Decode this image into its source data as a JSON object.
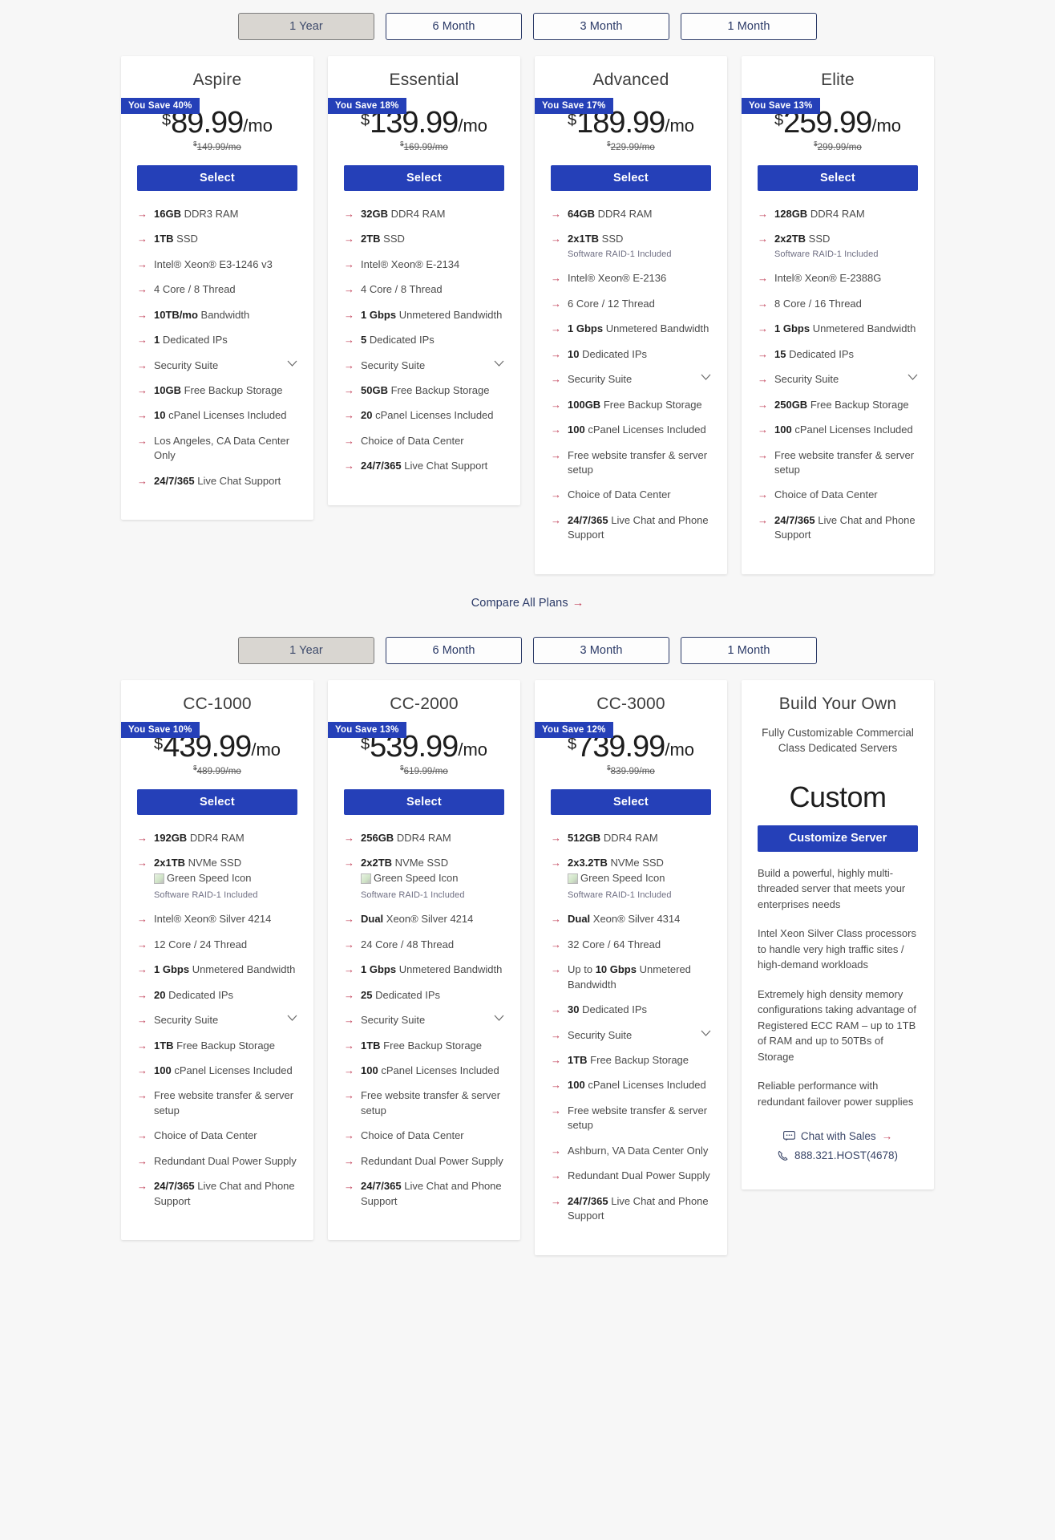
{
  "colors": {
    "accent_blue": "#2540b8",
    "arrow_red": "#c2415a",
    "navy": "#2b3a67",
    "page_bg": "#f7f7f7"
  },
  "terms_top": {
    "options": [
      {
        "label": "1 Year",
        "active": true
      },
      {
        "label": "6 Month",
        "active": false
      },
      {
        "label": "3 Month",
        "active": false
      },
      {
        "label": "1 Month",
        "active": false
      }
    ]
  },
  "terms_bottom": {
    "options": [
      {
        "label": "1 Year",
        "active": true
      },
      {
        "label": "6 Month",
        "active": false
      },
      {
        "label": "3 Month",
        "active": false
      },
      {
        "label": "1 Month",
        "active": false
      }
    ]
  },
  "compare": {
    "label": "Compare All Plans",
    "arrow": "→"
  },
  "select_label": "Select",
  "plans_top": [
    {
      "name": "Aspire",
      "save_badge": "You Save 40%",
      "currency": "$",
      "price": "89.99",
      "per": "/mo",
      "old_currency": "$",
      "old_price": "149.99/mo",
      "features": [
        {
          "bold": "16GB",
          "text": " DDR3 RAM"
        },
        {
          "bold": "1TB",
          "text": " SSD"
        },
        {
          "bold": "",
          "text": "Intel® Xeon® E3-1246 v3"
        },
        {
          "bold": "",
          "text": "4 Core / 8 Thread"
        },
        {
          "bold": "10TB/mo",
          "text": " Bandwidth"
        },
        {
          "bold": "1",
          "text": " Dedicated IPs"
        },
        {
          "bold": "",
          "text": "Security Suite",
          "chevron": true
        },
        {
          "bold": "10GB",
          "text": " Free Backup Storage"
        },
        {
          "bold": "10",
          "text": " cPanel Licenses Included"
        },
        {
          "bold": "",
          "text": "Los Angeles, CA Data Center Only"
        },
        {
          "bold": "24/7/365",
          "text": " Live Chat Support"
        }
      ]
    },
    {
      "name": "Essential",
      "save_badge": "You Save 18%",
      "currency": "$",
      "price": "139.99",
      "per": "/mo",
      "old_currency": "$",
      "old_price": "169.99/mo",
      "features": [
        {
          "bold": "32GB",
          "text": " DDR4 RAM"
        },
        {
          "bold": "2TB",
          "text": " SSD"
        },
        {
          "bold": "",
          "text": "Intel® Xeon® E-2134"
        },
        {
          "bold": "",
          "text": "4 Core / 8 Thread"
        },
        {
          "bold": "1 Gbps",
          "text": " Unmetered Bandwidth"
        },
        {
          "bold": "5",
          "text": " Dedicated IPs"
        },
        {
          "bold": "",
          "text": "Security Suite",
          "chevron": true
        },
        {
          "bold": "50GB",
          "text": " Free Backup Storage"
        },
        {
          "bold": "20",
          "text": " cPanel Licenses Included"
        },
        {
          "bold": "",
          "text": "Choice of Data Center"
        },
        {
          "bold": "24/7/365",
          "text": " Live Chat Support"
        }
      ]
    },
    {
      "name": "Advanced",
      "save_badge": "You Save 17%",
      "currency": "$",
      "price": "189.99",
      "per": "/mo",
      "old_currency": "$",
      "old_price": "229.99/mo",
      "features": [
        {
          "bold": "64GB",
          "text": " DDR4 RAM"
        },
        {
          "bold": "2x1TB",
          "text": " SSD",
          "note": "Software RAID-1 Included"
        },
        {
          "bold": "",
          "text": "Intel® Xeon® E-2136"
        },
        {
          "bold": "",
          "text": "6 Core / 12 Thread"
        },
        {
          "bold": "1 Gbps",
          "text": " Unmetered Bandwidth"
        },
        {
          "bold": "10",
          "text": " Dedicated IPs"
        },
        {
          "bold": "",
          "text": "Security Suite",
          "chevron": true
        },
        {
          "bold": "100GB",
          "text": " Free Backup Storage"
        },
        {
          "bold": "100",
          "text": " cPanel Licenses Included"
        },
        {
          "bold": "",
          "text": "Free website transfer & server setup"
        },
        {
          "bold": "",
          "text": "Choice of Data Center"
        },
        {
          "bold": "24/7/365",
          "text": " Live Chat and Phone Support"
        }
      ]
    },
    {
      "name": "Elite",
      "save_badge": "You Save 13%",
      "currency": "$",
      "price": "259.99",
      "per": "/mo",
      "old_currency": "$",
      "old_price": "299.99/mo",
      "features": [
        {
          "bold": "128GB",
          "text": " DDR4 RAM"
        },
        {
          "bold": "2x2TB",
          "text": " SSD",
          "note": "Software RAID-1 Included"
        },
        {
          "bold": "",
          "text": "Intel® Xeon® E-2388G"
        },
        {
          "bold": "",
          "text": "8 Core / 16 Thread"
        },
        {
          "bold": "1 Gbps",
          "text": " Unmetered Bandwidth"
        },
        {
          "bold": "15",
          "text": " Dedicated IPs"
        },
        {
          "bold": "",
          "text": "Security Suite",
          "chevron": true
        },
        {
          "bold": "250GB",
          "text": " Free Backup Storage"
        },
        {
          "bold": "100",
          "text": " cPanel Licenses Included"
        },
        {
          "bold": "",
          "text": "Free website transfer & server setup"
        },
        {
          "bold": "",
          "text": "Choice of Data Center"
        },
        {
          "bold": "24/7/365",
          "text": " Live Chat and Phone Support"
        }
      ]
    }
  ],
  "plans_bottom": [
    {
      "name": "CC-1000",
      "save_badge": "You Save 10%",
      "currency": "$",
      "price": "439.99",
      "per": "/mo",
      "old_currency": "$",
      "old_price": "489.99/mo",
      "features": [
        {
          "bold": "192GB",
          "text": " DDR4 RAM"
        },
        {
          "bold": "2x1TB",
          "text": " NVMe SSD",
          "img_alt": "Green Speed Icon",
          "note": "Software RAID-1 Included"
        },
        {
          "bold": "",
          "text": "Intel® Xeon® Silver 4214"
        },
        {
          "bold": "",
          "text": "12 Core / 24 Thread"
        },
        {
          "bold": "1 Gbps",
          "text": " Unmetered Bandwidth"
        },
        {
          "bold": "20",
          "text": " Dedicated IPs"
        },
        {
          "bold": "",
          "text": "Security Suite",
          "chevron": true
        },
        {
          "bold": "1TB",
          "text": " Free Backup Storage"
        },
        {
          "bold": "100",
          "text": " cPanel Licenses Included"
        },
        {
          "bold": "",
          "text": "Free website transfer & server setup"
        },
        {
          "bold": "",
          "text": "Choice of Data Center"
        },
        {
          "bold": "",
          "text": "Redundant Dual Power Supply"
        },
        {
          "bold": "24/7/365",
          "text": " Live Chat and Phone Support"
        }
      ]
    },
    {
      "name": "CC-2000",
      "save_badge": "You Save 13%",
      "currency": "$",
      "price": "539.99",
      "per": "/mo",
      "old_currency": "$",
      "old_price": "619.99/mo",
      "features": [
        {
          "bold": "256GB",
          "text": " DDR4 RAM"
        },
        {
          "bold": "2x2TB",
          "text": " NVMe SSD",
          "img_alt": "Green Speed Icon",
          "note": "Software RAID-1 Included"
        },
        {
          "bold": "Dual",
          "text": " Xeon® Silver 4214"
        },
        {
          "bold": "",
          "text": "24 Core / 48 Thread"
        },
        {
          "bold": "1 Gbps",
          "text": " Unmetered Bandwidth"
        },
        {
          "bold": "25",
          "text": " Dedicated IPs"
        },
        {
          "bold": "",
          "text": "Security Suite",
          "chevron": true
        },
        {
          "bold": "1TB",
          "text": " Free Backup Storage"
        },
        {
          "bold": "100",
          "text": " cPanel Licenses Included"
        },
        {
          "bold": "",
          "text": "Free website transfer & server setup"
        },
        {
          "bold": "",
          "text": "Choice of Data Center"
        },
        {
          "bold": "",
          "text": "Redundant Dual Power Supply"
        },
        {
          "bold": "24/7/365",
          "text": " Live Chat and Phone Support"
        }
      ]
    },
    {
      "name": "CC-3000",
      "save_badge": "You Save 12%",
      "currency": "$",
      "price": "739.99",
      "per": "/mo",
      "old_currency": "$",
      "old_price": "839.99/mo",
      "features": [
        {
          "bold": "512GB",
          "text": " DDR4 RAM"
        },
        {
          "bold": "2x3.2TB",
          "text": " NVMe SSD",
          "img_alt": "Green Speed Icon",
          "note": "Software RAID-1 Included"
        },
        {
          "bold": "Dual",
          "text": " Xeon® Silver 4314"
        },
        {
          "bold": "",
          "text": "32 Core / 64 Thread"
        },
        {
          "pre": "Up to ",
          "bold": "10 Gbps",
          "text": " Unmetered Bandwidth"
        },
        {
          "bold": "30",
          "text": " Dedicated IPs"
        },
        {
          "bold": "",
          "text": "Security Suite",
          "chevron": true
        },
        {
          "bold": "1TB",
          "text": " Free Backup Storage"
        },
        {
          "bold": "100",
          "text": " cPanel Licenses Included"
        },
        {
          "bold": "",
          "text": "Free website transfer & server setup"
        },
        {
          "bold": "",
          "text": "Ashburn, VA Data Center Only"
        },
        {
          "bold": "",
          "text": "Redundant Dual Power Supply"
        },
        {
          "bold": "24/7/365",
          "text": " Live Chat and Phone Support"
        }
      ]
    }
  ],
  "build_your_own": {
    "name": "Build Your Own",
    "subtitle": "Fully Customizable Commercial Class Dedicated Servers",
    "custom_label": "Custom",
    "button_label": "Customize Server",
    "paragraphs": [
      "Build a powerful, highly multi-threaded server that meets your enterprises needs",
      "Intel Xeon Silver Class processors to handle very high traffic sites / high-demand workloads",
      "Extremely high density memory configurations taking advantage of Registered ECC RAM – up to 1TB of RAM and up to 50TBs of Storage",
      "Reliable performance with redundant failover power supplies"
    ],
    "chat_label": "Chat with Sales",
    "chat_arrow": "→",
    "phone_label": "888.321.HOST(4678)"
  }
}
